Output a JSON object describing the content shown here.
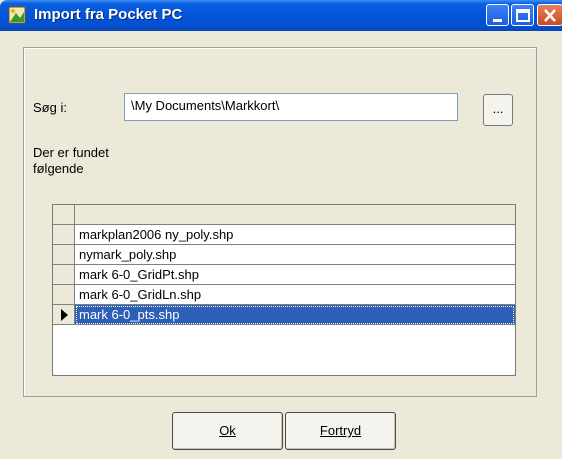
{
  "window": {
    "title": "Import fra Pocket PC",
    "controls": [
      "minimize-icon",
      "maximize-icon",
      "close-icon"
    ]
  },
  "form": {
    "search_label": "Søg i:",
    "path_value": "\\My Documents\\Markkort\\",
    "browse_label": "...",
    "found_label": "Der er fundet følgende"
  },
  "grid": {
    "rows": [
      {
        "name": "markplan2006 ny_poly.shp",
        "selected": false
      },
      {
        "name": "nymark_poly.shp",
        "selected": false
      },
      {
        "name": "mark 6-0_GridPt.shp",
        "selected": false
      },
      {
        "name": "mark 6-0_GridLn.shp",
        "selected": false
      },
      {
        "name": "mark 6-0_pts.shp",
        "selected": true
      }
    ],
    "selection_color": "#2e5fb7"
  },
  "buttons": {
    "ok_label": "Ok",
    "cancel_label": "Fortryd"
  },
  "colors": {
    "titlebar": "#0454d8",
    "dialog_bg": "#ece9d8"
  }
}
